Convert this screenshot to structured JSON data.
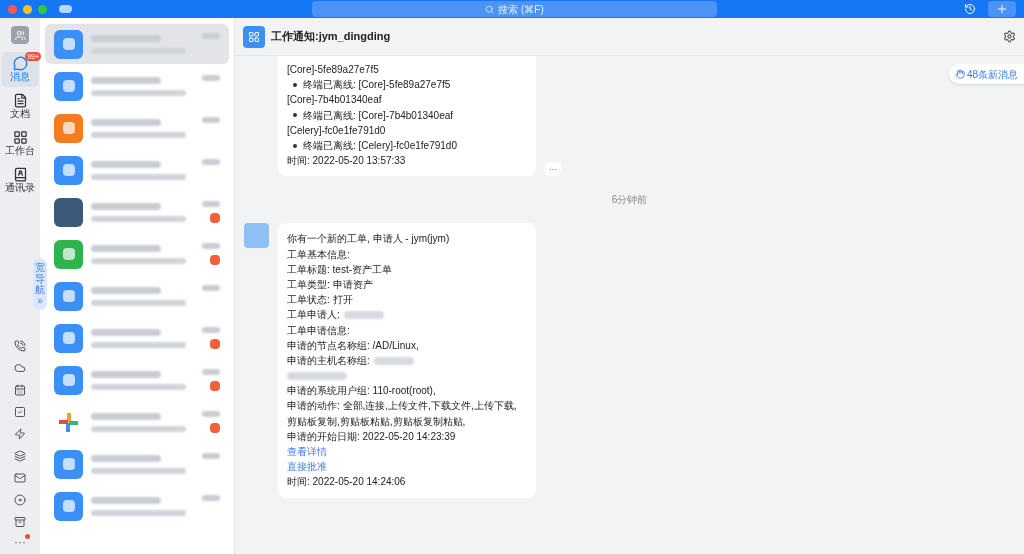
{
  "titlebar": {
    "search_placeholder": "搜索 (⌘F)"
  },
  "nav": {
    "items": [
      {
        "label": "消息",
        "selected": true,
        "badge": "99+"
      },
      {
        "label": "文档",
        "selected": false
      },
      {
        "label": "工作台",
        "selected": false
      },
      {
        "label": "通讯录",
        "selected": false
      }
    ],
    "expand_tab": {
      "label": "宽导航",
      "arrow": "»"
    },
    "more_label": "···",
    "more_dot": true
  },
  "chats": [
    {
      "color": "#3b8ff5",
      "kind": "tile",
      "selected": true,
      "unread": false
    },
    {
      "color": "#3b8ff5",
      "kind": "tile",
      "selected": false,
      "unread": false
    },
    {
      "color": "#f57c1f",
      "kind": "tile",
      "selected": false,
      "unread": false
    },
    {
      "color": "#3b8ff5",
      "kind": "tile",
      "selected": false,
      "unread": false
    },
    {
      "color": "#3b5a7a",
      "kind": "photo",
      "selected": false,
      "unread": true
    },
    {
      "color": "#2fb44b",
      "kind": "tile",
      "selected": false,
      "unread": true
    },
    {
      "color": "#3b8ff5",
      "kind": "tile",
      "selected": false,
      "unread": false
    },
    {
      "color": "#3b8ff5",
      "kind": "tile",
      "selected": false,
      "unread": true
    },
    {
      "color": "#3b8ff5",
      "kind": "tile",
      "selected": false,
      "unread": true
    },
    {
      "color": "#e8a23a",
      "kind": "logo",
      "selected": false,
      "unread": true
    },
    {
      "color": "#3b8ff5",
      "kind": "tile",
      "selected": false,
      "unread": false
    },
    {
      "color": "#3b8ff5",
      "kind": "tile",
      "selected": false,
      "unread": false
    }
  ],
  "conversation": {
    "title": "工作通知:jym_dingding",
    "new_messages": "48条新消息",
    "messages": [
      {
        "lines": [
          {
            "kind": "text",
            "text": "[Core]-5fe89a27e7f5"
          },
          {
            "kind": "bullet",
            "text": "终端已离线: [Core]-5fe89a27e7f5"
          },
          {
            "kind": "text",
            "text": "[Core]-7b4b01340eaf"
          },
          {
            "kind": "bullet",
            "text": "终端已离线: [Core]-7b4b01340eaf"
          },
          {
            "kind": "text",
            "text": "[Celery]-fc0e1fe791d0"
          },
          {
            "kind": "bullet",
            "text": "终端已离线: [Celery]-fc0e1fe791d0"
          },
          {
            "kind": "text",
            "text": "时间: 2022-05-20 13:57:33"
          }
        ],
        "more_button": "···"
      },
      {
        "divider": "6分钟前"
      },
      {
        "lines": [
          {
            "kind": "text",
            "text": "你有一个新的工单, 申请人 - jym(jym)"
          },
          {
            "kind": "text",
            "text": "工单基本信息:"
          },
          {
            "kind": "text",
            "text": "工单标题: test-资产工单"
          },
          {
            "kind": "text",
            "text": "工单类型: 申请资产"
          },
          {
            "kind": "text",
            "text": "工单状态: 打开"
          },
          {
            "kind": "redacted_after",
            "text": "工单申请人:"
          },
          {
            "kind": "text",
            "text": "工单申请信息:"
          },
          {
            "kind": "text",
            "text": "申请的节点名称组: /AD/Linux,"
          },
          {
            "kind": "redacted_after",
            "text": "申请的主机名称组:"
          },
          {
            "kind": "redacted"
          },
          {
            "kind": "text",
            "text": "申请的系统用户组: 110-root(root),"
          },
          {
            "kind": "text",
            "text": "申请的动作: 全部,连接,上传文件,下载文件,上传下载,"
          },
          {
            "kind": "text",
            "text": "剪贴板复制,剪贴板粘贴,剪贴板复制粘贴,"
          },
          {
            "kind": "text",
            "text": "申请的开始日期: 2022-05-20 14:23:39"
          },
          {
            "kind": "link",
            "text": "查看详情"
          },
          {
            "kind": "link",
            "text": "直接批准"
          },
          {
            "kind": "text",
            "text": "时间: 2022-05-20 14:24:06"
          }
        ]
      }
    ]
  }
}
